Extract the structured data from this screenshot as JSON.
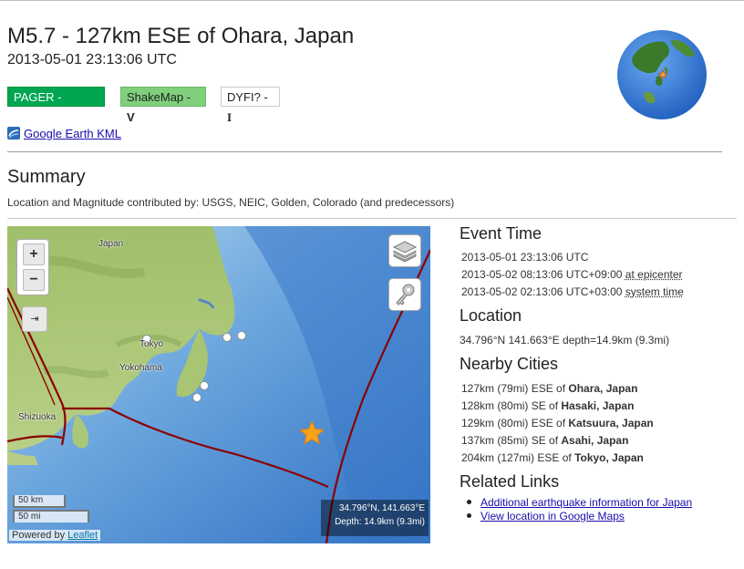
{
  "event": {
    "title": "M5.7 - 127km ESE of Ohara, Japan",
    "datetime": "2013-05-01 23:13:06 UTC"
  },
  "badges": {
    "pager_label": "PAGER - ",
    "pager_level": "GREEN",
    "pager_color": "#00a651",
    "shakemap_label": "ShakeMap - ",
    "shakemap_level": "V",
    "shakemap_color": "#7fcf7c",
    "dyfi_label": "DYFI? - ",
    "dyfi_level": "I"
  },
  "kml_link": "Google Earth KML",
  "summary": {
    "heading": "Summary",
    "contributors": "Location and Magnitude contributed by: USGS, NEIC, Golden, Colorado (and predecessors)"
  },
  "map": {
    "zoom_in": "+",
    "zoom_out": "−",
    "fullscreen_glyph": "⇥",
    "labels": {
      "japan": "Japan",
      "tokyo": "Tokyo",
      "yokohama": "Yokohama",
      "shizuoka": "Shizuoka"
    },
    "scale_km": "50 km",
    "scale_mi": "50 mi",
    "powered_by": "Powered by ",
    "leaflet": "Leaflet",
    "coords": "34.796°N, 141.663°E",
    "depth": "Depth: 14.9km (9.3mi)"
  },
  "event_time": {
    "heading": "Event Time",
    "utc": "2013-05-01 23:13:06 UTC",
    "epicenter_time": "2013-05-02 08:13:06 UTC+09:00 ",
    "epicenter_link": "at epicenter",
    "system_time": "2013-05-02 02:13:06 UTC+03:00 ",
    "system_link": "system time"
  },
  "location": {
    "heading": "Location",
    "text": "34.796°N 141.663°E depth=14.9km (9.3mi)"
  },
  "nearby": {
    "heading": "Nearby Cities",
    "cities": [
      {
        "prefix": "127km (79mi) ESE of ",
        "city": "Ohara, Japan"
      },
      {
        "prefix": "128km (80mi) SE of ",
        "city": "Hasaki, Japan"
      },
      {
        "prefix": "129km (80mi) ESE of ",
        "city": "Katsuura, Japan"
      },
      {
        "prefix": "137km (85mi) SE of ",
        "city": "Asahi, Japan"
      },
      {
        "prefix": "204km (127mi) ESE of ",
        "city": "Tokyo, Japan"
      }
    ]
  },
  "related": {
    "heading": "Related Links",
    "links": [
      "Additional earthquake information for Japan",
      "View location in Google Maps"
    ]
  },
  "icons": {
    "layers": "layers-icon",
    "key": "key-icon",
    "epicenter": "star-icon",
    "globe": "globe-icon"
  },
  "colors": {
    "link": "#1a0dab",
    "plate_boundary": "#8b0000",
    "star": "#f7a21b",
    "ocean": "#4a8fd8"
  }
}
